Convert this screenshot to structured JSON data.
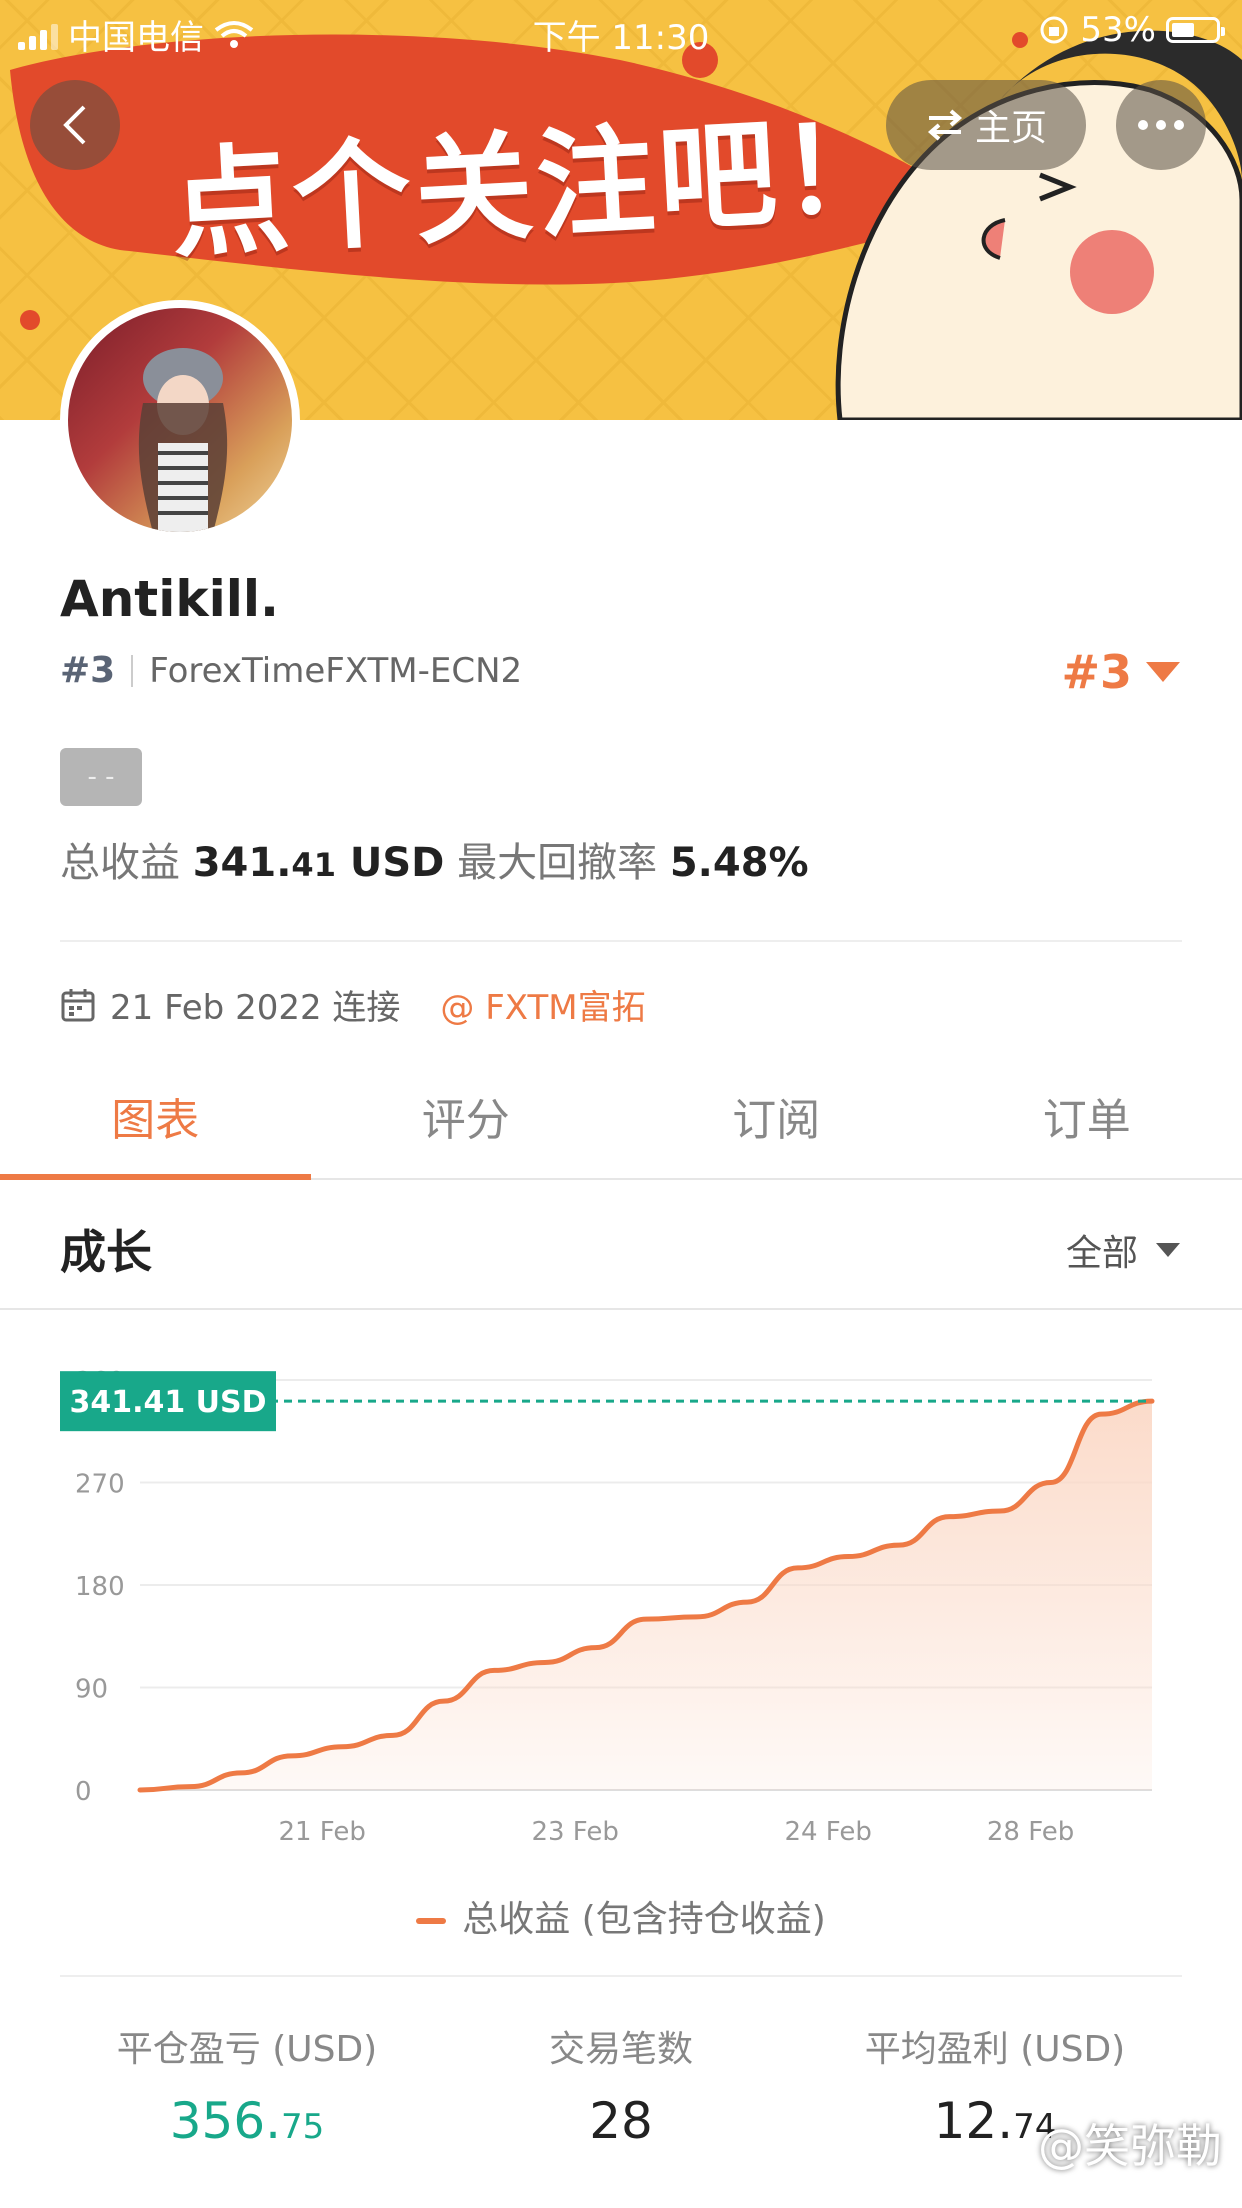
{
  "status_bar": {
    "carrier": "中国电信",
    "time": "下午 11:30",
    "battery": "53%",
    "battery_level": 0.53
  },
  "banner": {
    "slogan": "点个关注吧！"
  },
  "nav": {
    "home_label": "主页",
    "back_icon": "chevron-left-icon",
    "swap_icon": "swap-arrows-icon",
    "more_icon": "more-dots-icon"
  },
  "profile": {
    "name": "Antikill.",
    "rank": "#3",
    "server": "ForexTimeFXTM-ECN2",
    "rank_badge": "#3",
    "tag": "- -",
    "total_profit_label": "总收益",
    "total_profit_int": "341.",
    "total_profit_dec": "41",
    "total_profit_unit": "USD",
    "max_drawdown_label": "最大回撤率",
    "max_drawdown": "5.48%",
    "connected_date": "21 Feb 2022 连接",
    "broker": "@ FXTM富拓"
  },
  "tabs": [
    {
      "label": "图表",
      "active": true
    },
    {
      "label": "评分",
      "active": false
    },
    {
      "label": "订阅",
      "active": false
    },
    {
      "label": "订单",
      "active": false
    }
  ],
  "section": {
    "title": "成长",
    "filter": "全部"
  },
  "chart_data": {
    "type": "area",
    "current_value_label": "341.41 USD",
    "x_ticks": [
      "21 Feb",
      "23 Feb",
      "24 Feb",
      "28 Feb"
    ],
    "y_ticks": [
      0,
      90,
      180,
      270,
      360
    ],
    "ylim": [
      0,
      360
    ],
    "series": [
      {
        "name": "总收益 (包含持仓收益)",
        "values": [
          0,
          3,
          15,
          30,
          38,
          48,
          78,
          105,
          112,
          125,
          150,
          152,
          165,
          195,
          205,
          215,
          240,
          245,
          270,
          330,
          341.41
        ]
      }
    ],
    "colors": {
      "line": "#ee7a45",
      "fill": "#fbd9c7",
      "marker": "#18a88a"
    }
  },
  "legend_label": "总收益 (包含持仓收益)",
  "bottom_stats": [
    {
      "label": "平仓盈亏 (USD)",
      "int": "356.",
      "dec": "75"
    },
    {
      "label": "交易笔数",
      "int": "28",
      "dec": ""
    },
    {
      "label": "平均盈利 (USD)",
      "int": "12.",
      "dec": "74"
    }
  ],
  "watermark": "@笑弥勒",
  "colors": {
    "accent": "#ee7a45",
    "green": "#18a88a"
  }
}
